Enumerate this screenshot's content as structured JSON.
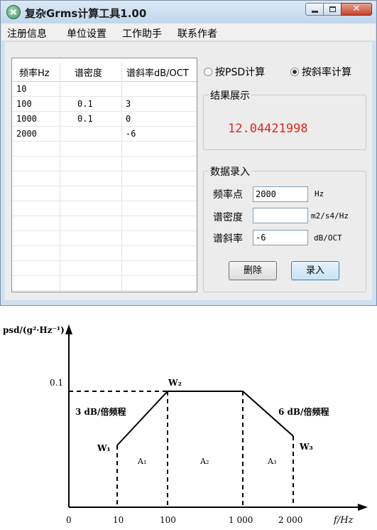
{
  "window": {
    "title": "复杂Grms计算工具1.00",
    "close_glyph": "✕"
  },
  "menu": [
    "注册信息",
    "单位设置",
    "工作助手",
    "联系作者"
  ],
  "table": {
    "headers": [
      "频率Hz",
      "谱密度",
      "谱斜率dB/OCT"
    ],
    "rows": [
      [
        "10",
        "",
        ""
      ],
      [
        "100",
        "0.1",
        "3"
      ],
      [
        "1000",
        "0.1",
        "0"
      ],
      [
        "2000",
        "",
        "-6"
      ]
    ]
  },
  "mode": {
    "psd_label": "按PSD计算",
    "slope_label": "按斜率计算",
    "selected": "slope"
  },
  "result": {
    "group_label": "结果展示",
    "value": "12.04421998",
    "value_color": "#e0281c"
  },
  "entry": {
    "group_label": "数据录入",
    "freq_label": "频率点",
    "freq_value": "2000",
    "freq_unit": "Hz",
    "density_label": "谱密度",
    "density_value": "",
    "density_unit": "m2/s4/Hz",
    "slope_label": "谱斜率",
    "slope_value": "-6",
    "slope_unit": "dB/OCT",
    "delete_label": "删除",
    "enter_label": "录入"
  },
  "diagram": {
    "ylabel": "psd/(g²·Hz⁻¹)",
    "xlabel": "f/Hz",
    "y_tick": "0.1",
    "x_ticks": [
      "0",
      "10",
      "100",
      "1 000",
      "2 000"
    ],
    "points": [
      "W₁",
      "W₂",
      "W₃"
    ],
    "areas": [
      "A₁",
      "A₂",
      "A₃"
    ],
    "slope_up": "3 dB/倍频程",
    "slope_down": "6 dB/倍频程"
  }
}
